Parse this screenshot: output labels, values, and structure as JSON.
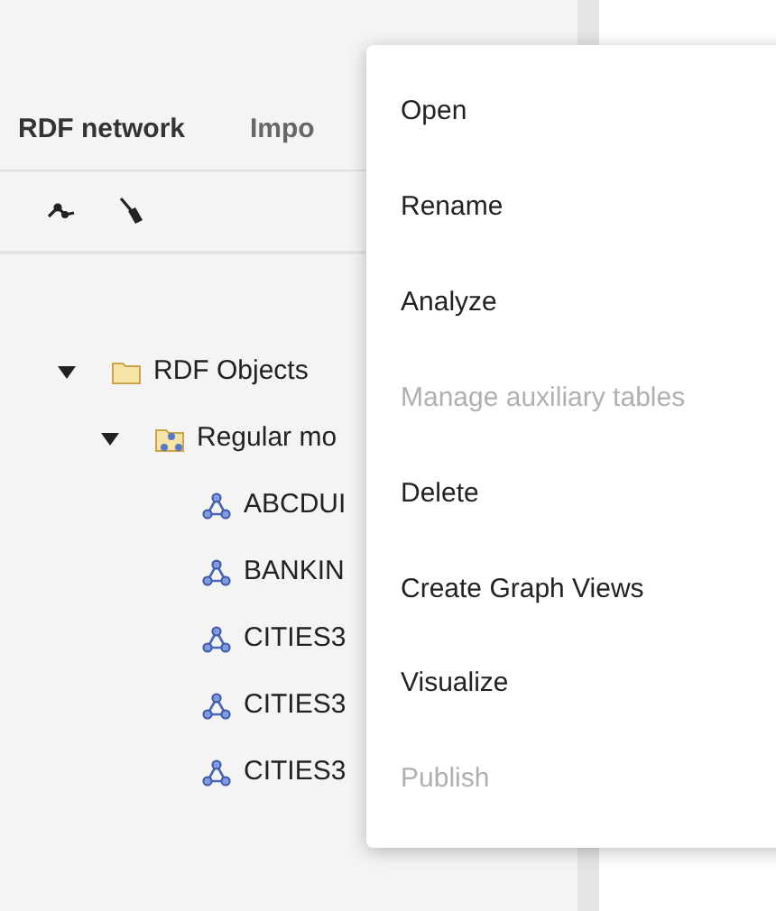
{
  "tabs": [
    {
      "label": "RDF network",
      "selected": true
    },
    {
      "label": "Impo",
      "selected": false
    }
  ],
  "tree": [
    {
      "label": "RDF Objects",
      "kind": "folder",
      "expanded": true,
      "children": [
        {
          "label": "Regular mo",
          "kind": "model-folder",
          "expanded": true,
          "children": [
            {
              "label": "ABCDUI",
              "kind": "model"
            },
            {
              "label": "BANKIN",
              "kind": "model"
            },
            {
              "label": "CITIES3",
              "kind": "model"
            },
            {
              "label": "CITIES3",
              "kind": "model"
            },
            {
              "label": "CITIES3",
              "kind": "model"
            }
          ]
        }
      ]
    }
  ],
  "context_menu": [
    {
      "label": "Open",
      "disabled": false
    },
    {
      "label": "Rename",
      "disabled": false
    },
    {
      "label": "Analyze",
      "disabled": false
    },
    {
      "label": "Manage auxiliary tables",
      "disabled": true
    },
    {
      "label": "Delete",
      "disabled": false
    },
    {
      "label": "Create Graph Views",
      "disabled": false
    },
    {
      "label": "Visualize",
      "disabled": false
    },
    {
      "label": "Publish",
      "disabled": true
    }
  ]
}
